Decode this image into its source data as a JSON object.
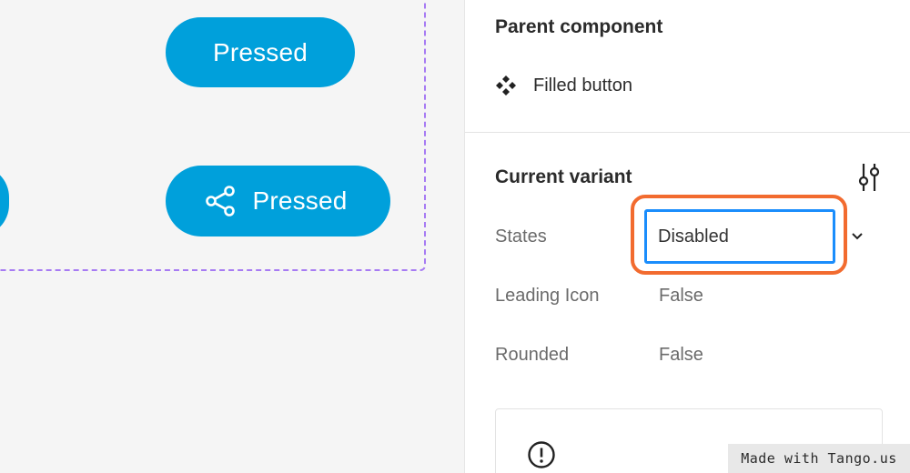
{
  "canvas": {
    "buttons": [
      {
        "label": "Pressed",
        "has_icon": false
      },
      {
        "label": "Pressed",
        "has_icon": true,
        "icon": "share-icon"
      }
    ],
    "button_color": "#00a0db",
    "frame_border_color": "#a77bf3"
  },
  "panel": {
    "parent_component": {
      "title": "Parent component",
      "name": "Filled button",
      "icon": "component-icon"
    },
    "current_variant": {
      "title": "Current variant",
      "icon": "adjust-icon",
      "properties": {
        "states": {
          "label": "States",
          "value": "Disabled"
        },
        "leading_icon": {
          "label": "Leading Icon",
          "value": "False"
        },
        "rounded": {
          "label": "Rounded",
          "value": "False"
        }
      }
    },
    "notice_icon": "alert-circle-icon",
    "highlight_color": "#f26b2f",
    "input_focus_color": "#1a8dfc"
  },
  "watermark": "Made with Tango.us"
}
